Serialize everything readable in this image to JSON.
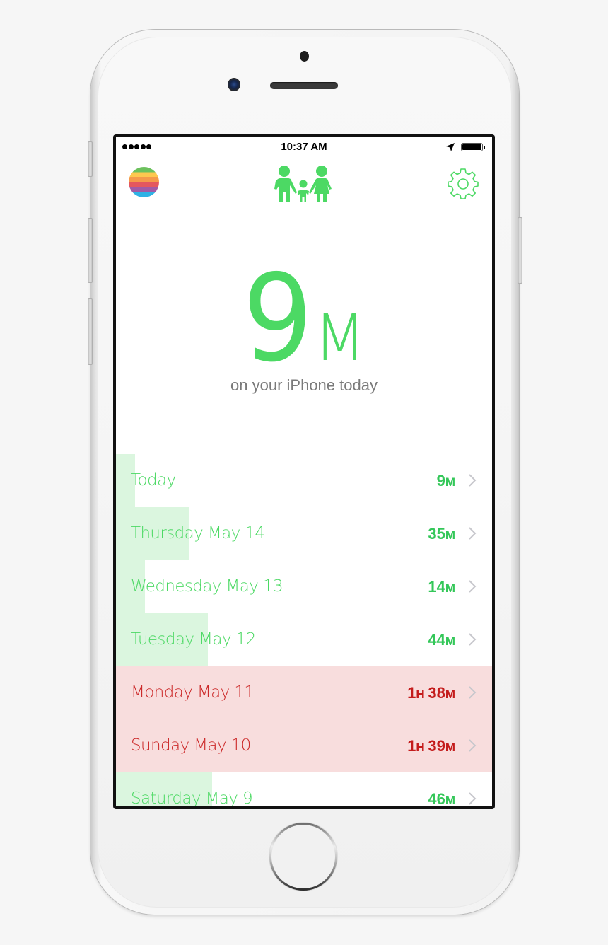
{
  "status_bar": {
    "signal_dots": 5,
    "time": "10:37 AM",
    "location_icon": "location-arrow-icon",
    "battery_icon": "battery-full-icon"
  },
  "nav": {
    "left_icon": "rainbow-profile-avatar",
    "center_icon": "family-icon",
    "right_icon": "gear-icon"
  },
  "hero": {
    "value": "9",
    "unit": "M",
    "caption": "on your iPhone today"
  },
  "colors": {
    "accent_green": "#4cd964",
    "bar_green": "#dbf6df",
    "alert_red": "#c41c1c",
    "alert_bg": "#f8dddd"
  },
  "days": [
    {
      "label": "Today",
      "hours": "",
      "minutes": "9",
      "total_minutes": 9,
      "over_limit": false
    },
    {
      "label": "Thursday May 14",
      "hours": "",
      "minutes": "35",
      "total_minutes": 35,
      "over_limit": false
    },
    {
      "label": "Wednesday May 13",
      "hours": "",
      "minutes": "14",
      "total_minutes": 14,
      "over_limit": false
    },
    {
      "label": "Tuesday May 12",
      "hours": "",
      "minutes": "44",
      "total_minutes": 44,
      "over_limit": false
    },
    {
      "label": "Monday May 11",
      "hours": "1",
      "minutes": "38",
      "total_minutes": 98,
      "over_limit": true
    },
    {
      "label": "Sunday May 10",
      "hours": "1",
      "minutes": "39",
      "total_minutes": 99,
      "over_limit": true
    },
    {
      "label": "Saturday May 9",
      "hours": "",
      "minutes": "46",
      "total_minutes": 46,
      "over_limit": false
    }
  ],
  "units": {
    "hour": "H",
    "minute": "M"
  },
  "bar_scale_max_minutes": 90
}
